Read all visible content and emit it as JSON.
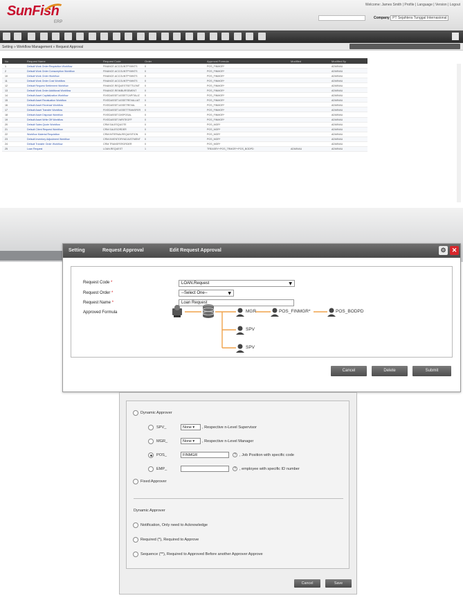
{
  "app": {
    "logo": "SunFish",
    "logo_sub": "ERP",
    "welcome": "Welcome: James Smith | Profile | Language | Version | Logout",
    "company_label": "Company",
    "company_value": "PT Sejahtera Tunggal Internasional"
  },
  "breadcrumb": "Setting  »  Workflow Management  »  Request Approval",
  "grid": {
    "headers": [
      "No",
      "Request Name",
      "Request Code",
      "Order",
      "Approval Formula",
      "Modified",
      "Modified By"
    ],
    "rows": [
      {
        "no": "1",
        "name": "Default Work Order Requisition Workflow",
        "code": "FINANCE.ACCOUNTPYMNTS",
        "order": "0",
        "formula": "POS_FINMGR*",
        "mod": "",
        "by": "ADMIN4U"
      },
      {
        "no": "2",
        "name": "Default Work Order Consumption Workflow",
        "code": "FINANCE.ACCOUNTPYMNTS",
        "order": "0",
        "formula": "POS_FINMGR*",
        "mod": "",
        "by": "ADMIN4U"
      },
      {
        "no": "10",
        "name": "Default Work Order Workflow",
        "code": "FINANCE.ACCOUNTPYMNTS",
        "order": "0",
        "formula": "POS_FINMGR*",
        "mod": "",
        "by": "ADMIN4U"
      },
      {
        "no": "11",
        "name": "Default Work Order Cost Workflow",
        "code": "FINANCE.ACCOUNTPYMNTS",
        "order": "0",
        "formula": "POS_FINMGR*",
        "mod": "",
        "by": "ADMIN4U"
      },
      {
        "no": "12",
        "name": "Default Request Settlement Workflow",
        "code": "FINANCE.REQUESTSETTLEMT",
        "order": "0",
        "formula": "POS_FINMGR*",
        "mod": "",
        "by": "ADMIN4U"
      },
      {
        "no": "13",
        "name": "Default Work Order Additional Workflow",
        "code": "FINANCE.REIMBURSEMENT",
        "order": "0",
        "formula": "POS_FINMGR*",
        "mod": "",
        "by": "ADMIN4U"
      },
      {
        "no": "14",
        "name": "Default Asset Capitalization Workflow",
        "code": "FIXEDASSET.ASSETCAPITALIZ",
        "order": "0",
        "formula": "POS_FINMGR*",
        "mod": "",
        "by": "ADMIN4U"
      },
      {
        "no": "15",
        "name": "Default Asset Revaluation Workflow",
        "code": "FIXEDASSET.ASSETREVALUAT",
        "order": "0",
        "formula": "POS_FINMGR*",
        "mod": "",
        "by": "ADMIN4U"
      },
      {
        "no": "16",
        "name": "Default Asset Reversal Workflow",
        "code": "FIXEDASSET.ASSETREVAL",
        "order": "0",
        "formula": "POS_FINMGR*",
        "mod": "",
        "by": "ADMIN4U"
      },
      {
        "no": "17",
        "name": "Default Asset Transfer Workflow",
        "code": "FIXEDASSET.ASSETTRANSFER",
        "order": "0",
        "formula": "POS_FINMGR*",
        "mod": "",
        "by": "ADMIN4U"
      },
      {
        "no": "18",
        "name": "Default Asset Disposal Workflow",
        "code": "FIXEDASSET.DISPOSAL",
        "order": "0",
        "formula": "POS_FINMGR*",
        "mod": "",
        "by": "ADMIN4U"
      },
      {
        "no": "19",
        "name": "Default Asset Write Off Workflow",
        "code": "FIXEDASSET.WRITEOFF",
        "order": "0",
        "formula": "POS_FINMGR*",
        "mod": "",
        "by": "ADMIN4U"
      },
      {
        "no": "20",
        "name": "Default Sales Quote Workflow",
        "code": "CRM.SALESQUOTE",
        "order": "0",
        "formula": "POS_MGR*",
        "mod": "",
        "by": "ADMIN4U"
      },
      {
        "no": "21",
        "name": "Default Client Request Workflow",
        "code": "CRM.SALESORDER",
        "order": "0",
        "formula": "POS_MGR*",
        "mod": "",
        "by": "ADMIN4U"
      },
      {
        "no": "22",
        "name": "Workflow Material Requisition",
        "code": "CRM.INTERNALREQUISITION",
        "order": "0",
        "formula": "POS_MGR*",
        "mod": "",
        "by": "ADMIN4U"
      },
      {
        "no": "23",
        "name": "Default Inventory Adjustment Workflow",
        "code": "CRM.INVENTORYADJUSTMENT",
        "order": "0",
        "formula": "POS_MGR*",
        "mod": "",
        "by": "ADMIN4U"
      },
      {
        "no": "24",
        "name": "Default Transfer Order Workflow",
        "code": "CRM.TRANSFERORDER",
        "order": "0",
        "formula": "POS_MGR*",
        "mod": "",
        "by": "ADMIN4U"
      },
      {
        "no": "25",
        "name": "Loan Request",
        "code": "LOAN.REQUEST",
        "order": "1",
        "formula": "TREASRY+POS_TRMGR*+POS_BODPD",
        "mod": "ADMIN4U",
        "by": "ADMIN4U"
      }
    ]
  },
  "dialog": {
    "crumbs": [
      "Setting",
      "Request Approval",
      "Edit Request Approval"
    ],
    "fields": {
      "code_label": "Request Code",
      "code_value": "LOAN.Request",
      "order_label": "Request Order",
      "order_value": "--Select One--",
      "name_label": "Request Name",
      "name_value": "Loan Request",
      "formula_label": "Approved Formula"
    },
    "nodes": {
      "mgr": "MGR",
      "finmgr": "POS_FINMGR*",
      "bodpd": "POS_BODPD",
      "spv1": "SPV",
      "spv2": "SPV"
    },
    "buttons": {
      "cancel": "Cancel",
      "delete": "Delete",
      "submit": "Submit"
    }
  },
  "approver": {
    "dynamic_title": "Dynamic Approver",
    "spv_label": "SPV_",
    "spv_select": "None",
    "spv_desc": ", Respective n-Level Supervisor",
    "mgr_label": "MGR_",
    "mgr_select": "None",
    "mgr_desc": ", Respective n-Level Manager",
    "pos_label": "POS_",
    "pos_value": "FINMGR",
    "pos_desc": ", Job Position with specific code",
    "emp_label": "EMP_",
    "emp_value": "",
    "emp_desc": ", employee with specific ID number",
    "fixed": "Fixed Approver",
    "section2_title": "Dynamic Approver",
    "notif": "Notification, Only need to Acknowledge",
    "required": "Required (*), Required to Approve",
    "sequence": "Sequence (**), Required to Approved Before another Approver Approve",
    "cancel": "Cancel",
    "save": "Save"
  }
}
